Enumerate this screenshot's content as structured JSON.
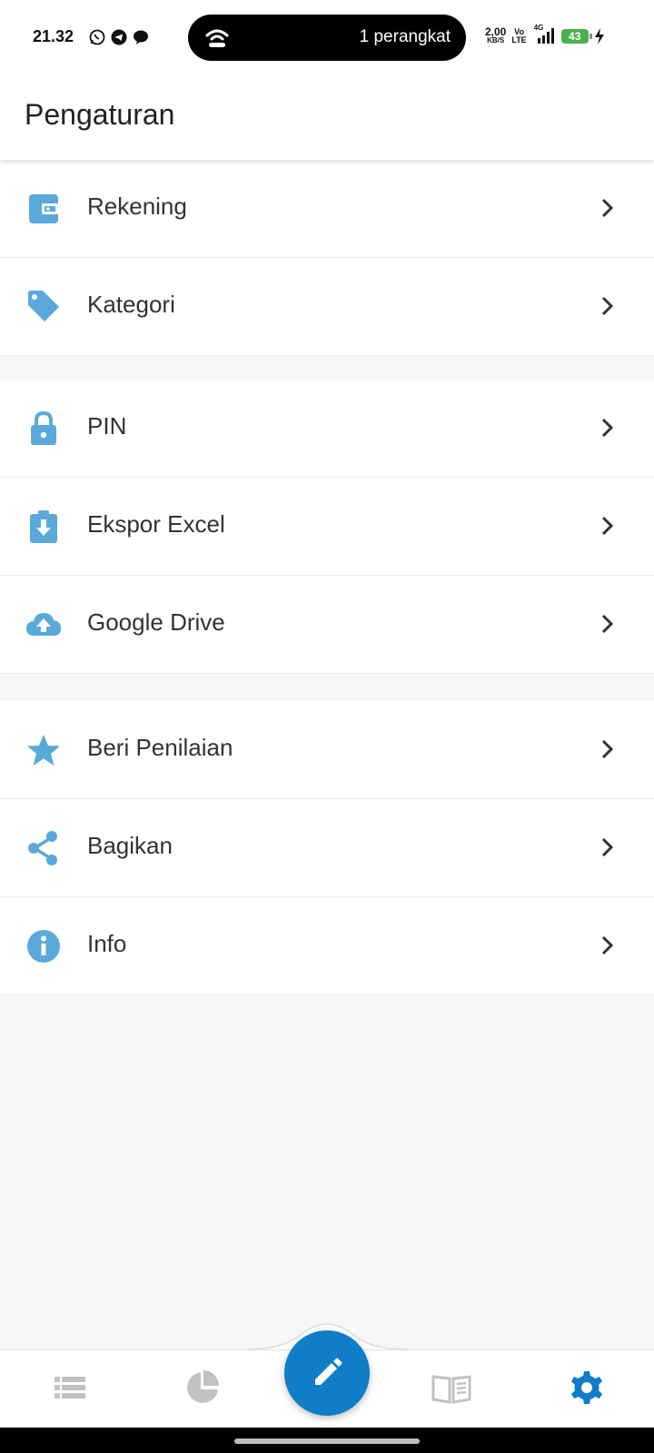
{
  "status_bar": {
    "time": "21.32",
    "hotspot_text": "1 perangkat",
    "speed_value": "2,00",
    "speed_unit": "KB/S",
    "volte_top": "Vo",
    "volte_bottom": "LTE",
    "network": "4G",
    "battery": "43",
    "app_icons": [
      "whatsapp-icon",
      "telegram-icon",
      "messenger-icon"
    ]
  },
  "app_bar": {
    "title": "Pengaturan"
  },
  "groups": [
    {
      "items": [
        {
          "label": "Rekening",
          "icon": "wallet-icon"
        },
        {
          "label": "Kategori",
          "icon": "tag-icon"
        }
      ]
    },
    {
      "items": [
        {
          "label": "PIN",
          "icon": "lock-icon"
        },
        {
          "label": "Ekspor Excel",
          "icon": "download-clipboard-icon"
        },
        {
          "label": "Google Drive",
          "icon": "cloud-upload-icon"
        }
      ]
    },
    {
      "items": [
        {
          "label": "Beri Penilaian",
          "icon": "star-icon"
        },
        {
          "label": "Bagikan",
          "icon": "share-icon"
        },
        {
          "label": "Info",
          "icon": "info-icon"
        }
      ]
    }
  ],
  "bottom_nav": {
    "items": [
      {
        "icon": "list-icon",
        "active": false
      },
      {
        "icon": "pie-chart-icon",
        "active": false
      },
      {
        "icon": "edit-icon",
        "active": false
      },
      {
        "icon": "book-icon",
        "active": false
      },
      {
        "icon": "settings-icon",
        "active": true
      }
    ]
  },
  "colors": {
    "accent": "#5aa9da",
    "fab": "#0f7dc8",
    "active_nav": "#0f7dc8",
    "inactive_nav": "#c2c2c2",
    "background": "#f7f7f7"
  }
}
